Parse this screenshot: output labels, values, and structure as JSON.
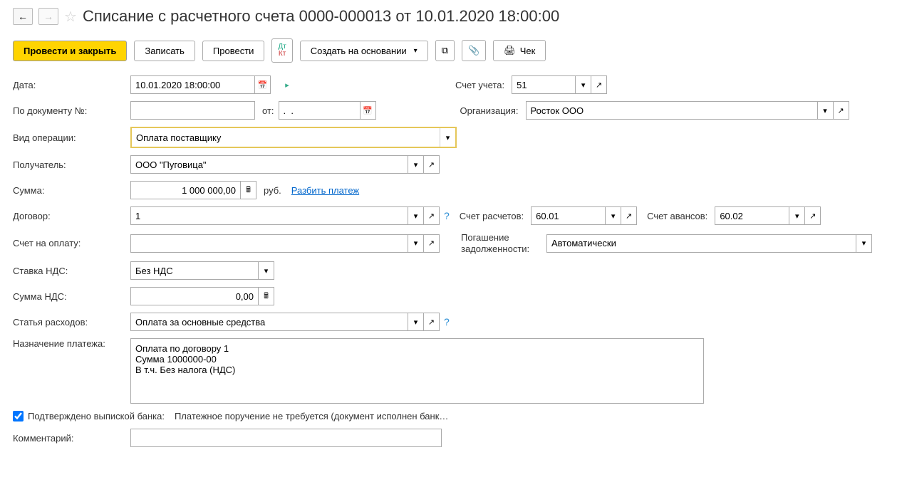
{
  "page_title": "Списание с расчетного счета 0000-000013 от 10.01.2020 18:00:00",
  "toolbar": {
    "post_and_close": "Провести и закрыть",
    "write": "Записать",
    "post": "Провести",
    "create_based": "Создать на основании",
    "receipt": "Чек"
  },
  "labels": {
    "date": "Дата:",
    "doc_number": "По документу №:",
    "from": "от:",
    "operation_type": "Вид операции:",
    "recipient": "Получатель:",
    "sum": "Сумма:",
    "currency": "руб.",
    "split_payment": "Разбить платеж",
    "contract": "Договор:",
    "invoice": "Счет на оплату:",
    "vat_rate": "Ставка НДС:",
    "vat_sum": "Сумма НДС:",
    "expense_item": "Статья расходов:",
    "purpose": "Назначение платежа:",
    "confirmed": "Подтверждено выпиской банка:",
    "payment_note": "Платежное поручение не требуется (документ исполнен банк…",
    "comment": "Комментарий:",
    "account": "Счет учета:",
    "organization": "Организация:",
    "settlement_account": "Счет расчетов:",
    "advance_account": "Счет авансов:",
    "debt_repayment": "Погашение задолженности:"
  },
  "values": {
    "date": "10.01.2020 18:00:00",
    "doc_number": "",
    "doc_date": ".  .",
    "operation_type": "Оплата поставщику",
    "recipient": "ООО \"Пуговица\"",
    "sum": "1 000 000,00",
    "contract": "1",
    "invoice": "",
    "vat_rate": "Без НДС",
    "vat_sum": "0,00",
    "expense_item": "Оплата за основные средства",
    "purpose": "Оплата по договору 1\nСумма 1000000-00\nВ т.ч. Без налога (НДС)",
    "comment": "",
    "account": "51",
    "organization": "Росток ООО",
    "settlement_account": "60.01",
    "advance_account": "60.02",
    "debt_repayment": "Автоматически"
  }
}
